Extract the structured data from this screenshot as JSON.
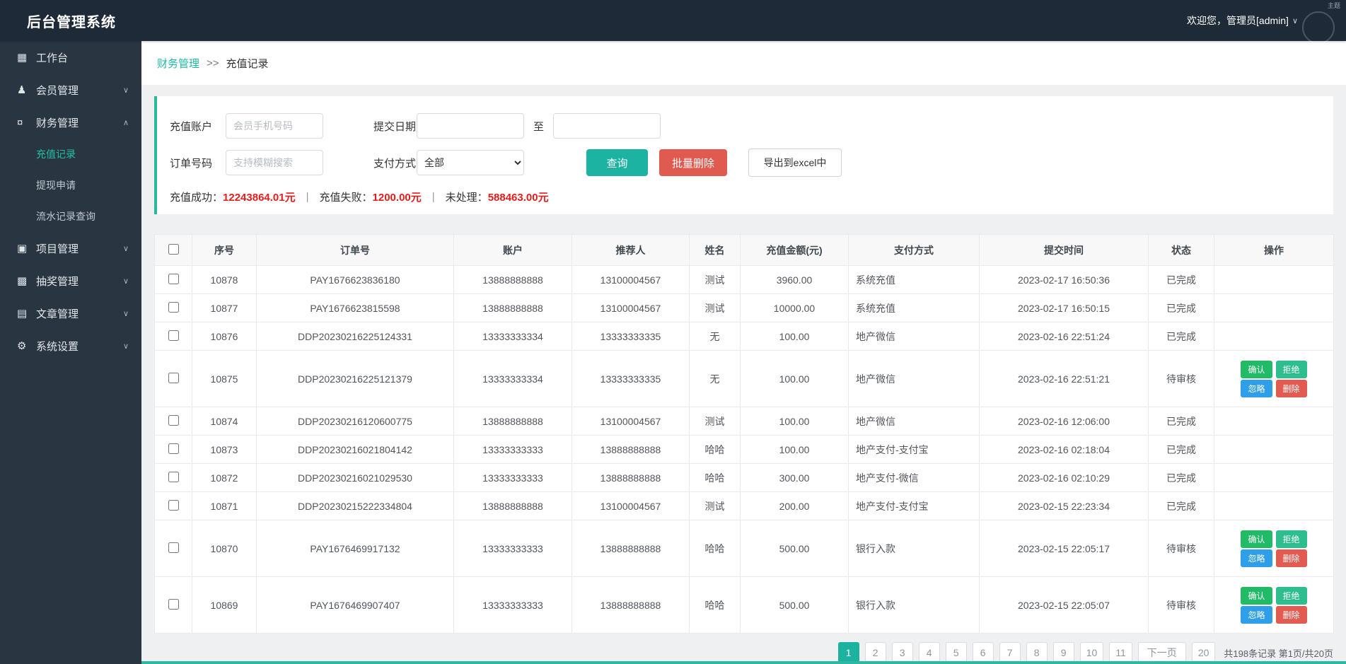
{
  "topbar": {
    "title": "后台管理系统",
    "welcome": "欢迎您，管理员[admin]",
    "caret": "∨",
    "theme_hint": "主题"
  },
  "sidebar": {
    "items": [
      {
        "key": "workbench",
        "label": "工作台",
        "icon": "grid-icon",
        "expandable": false,
        "expanded": false
      },
      {
        "key": "members",
        "label": "会员管理",
        "icon": "user-icon",
        "expandable": true,
        "expanded": false
      },
      {
        "key": "finance",
        "label": "财务管理",
        "icon": "coin-icon",
        "expandable": true,
        "expanded": true,
        "children": [
          {
            "key": "recharge-records",
            "label": "充值记录",
            "active": true
          },
          {
            "key": "withdraw-apply",
            "label": "提现申请",
            "active": false
          },
          {
            "key": "flow-records",
            "label": "流水记录查询",
            "active": false
          }
        ]
      },
      {
        "key": "projects",
        "label": "项目管理",
        "icon": "list-icon",
        "expandable": true,
        "expanded": false
      },
      {
        "key": "lottery",
        "label": "抽奖管理",
        "icon": "gift-icon",
        "expandable": true,
        "expanded": false
      },
      {
        "key": "articles",
        "label": "文章管理",
        "icon": "doc-icon",
        "expandable": true,
        "expanded": false
      },
      {
        "key": "settings",
        "label": "系统设置",
        "icon": "gear-icon",
        "expandable": true,
        "expanded": false
      }
    ]
  },
  "breadcrumb": {
    "section": "财务管理",
    "separator": ">>",
    "current": "充值记录"
  },
  "filters": {
    "account_label": "充值账户",
    "account_placeholder": "会员手机号码",
    "date_label": "提交日期",
    "date_to": "至",
    "order_label": "订单号码",
    "order_placeholder": "支持模糊搜索",
    "pay_label": "支付方式",
    "pay_selected": "全部",
    "query_button": "查询",
    "batch_delete_button": "批量删除",
    "export_button": "导出到excel中",
    "stats": {
      "success_label": "充值成功：",
      "success_value": "12243864.01元",
      "fail_label": "充值失败：",
      "fail_value": "1200.00元",
      "pending_label": "未处理：",
      "pending_value": "588463.00元",
      "divider": "|"
    }
  },
  "table": {
    "headers": [
      "序号",
      "订单号",
      "账户",
      "推荐人",
      "姓名",
      "充值金额(元)",
      "支付方式",
      "提交时间",
      "状态",
      "操作"
    ],
    "action_labels": {
      "confirm": "确认",
      "reject": "拒绝",
      "ignore": "忽略",
      "delete": "删除"
    },
    "rows": [
      {
        "id": "10878",
        "order": "PAY1676623836180",
        "account": "13888888888",
        "referrer": "13100004567",
        "name": "测试",
        "amount": "3960.00",
        "method": "系统充值",
        "time": "2023-02-17 16:50:36",
        "status": "已完成",
        "actions": false
      },
      {
        "id": "10877",
        "order": "PAY1676623815598",
        "account": "13888888888",
        "referrer": "13100004567",
        "name": "测试",
        "amount": "10000.00",
        "method": "系统充值",
        "time": "2023-02-17 16:50:15",
        "status": "已完成",
        "actions": false
      },
      {
        "id": "10876",
        "order": "DDP20230216225124331",
        "account": "13333333334",
        "referrer": "13333333335",
        "name": "无",
        "amount": "100.00",
        "method": "地产微信",
        "time": "2023-02-16 22:51:24",
        "status": "已完成",
        "actions": false
      },
      {
        "id": "10875",
        "order": "DDP20230216225121379",
        "account": "13333333334",
        "referrer": "13333333335",
        "name": "无",
        "amount": "100.00",
        "method": "地产微信",
        "time": "2023-02-16 22:51:21",
        "status": "待审核",
        "actions": true
      },
      {
        "id": "10874",
        "order": "DDP20230216120600775",
        "account": "13888888888",
        "referrer": "13100004567",
        "name": "测试",
        "amount": "100.00",
        "method": "地产微信",
        "time": "2023-02-16 12:06:00",
        "status": "已完成",
        "actions": false
      },
      {
        "id": "10873",
        "order": "DDP20230216021804142",
        "account": "13333333333",
        "referrer": "13888888888",
        "name": "哈哈",
        "amount": "100.00",
        "method": "地产支付-支付宝",
        "time": "2023-02-16 02:18:04",
        "status": "已完成",
        "actions": false
      },
      {
        "id": "10872",
        "order": "DDP20230216021029530",
        "account": "13333333333",
        "referrer": "13888888888",
        "name": "哈哈",
        "amount": "300.00",
        "method": "地产支付-微信",
        "time": "2023-02-16 02:10:29",
        "status": "已完成",
        "actions": false
      },
      {
        "id": "10871",
        "order": "DDP20230215222334804",
        "account": "13888888888",
        "referrer": "13100004567",
        "name": "测试",
        "amount": "200.00",
        "method": "地产支付-支付宝",
        "time": "2023-02-15 22:23:34",
        "status": "已完成",
        "actions": false
      },
      {
        "id": "10870",
        "order": "PAY1676469917132",
        "account": "13333333333",
        "referrer": "13888888888",
        "name": "哈哈",
        "amount": "500.00",
        "method": "银行入款",
        "time": "2023-02-15 22:05:17",
        "status": "待审核",
        "actions": true
      },
      {
        "id": "10869",
        "order": "PAY1676469907407",
        "account": "13333333333",
        "referrer": "13888888888",
        "name": "哈哈",
        "amount": "500.00",
        "method": "银行入款",
        "time": "2023-02-15 22:05:07",
        "status": "待审核",
        "actions": true
      }
    ]
  },
  "pagination": {
    "pages": [
      "1",
      "2",
      "3",
      "4",
      "5",
      "6",
      "7",
      "8",
      "9",
      "10",
      "11"
    ],
    "active": "1",
    "next": "下一页",
    "last": "20",
    "summary": "共198条记录 第1页/共20页"
  },
  "colors": {
    "topbar_bg": "#1e2a38",
    "sidebar_bg": "#2a3542",
    "accent_teal": "#1cb3a2",
    "danger_red": "#e05a50",
    "stat_value_red": "#e31d1c",
    "active_menu_teal": "#1fc2a7",
    "confirm_green": "#21ba66",
    "reject_green": "#2dbd8f",
    "ignore_blue": "#2e9fe8",
    "delete_red": "#e25b50"
  }
}
